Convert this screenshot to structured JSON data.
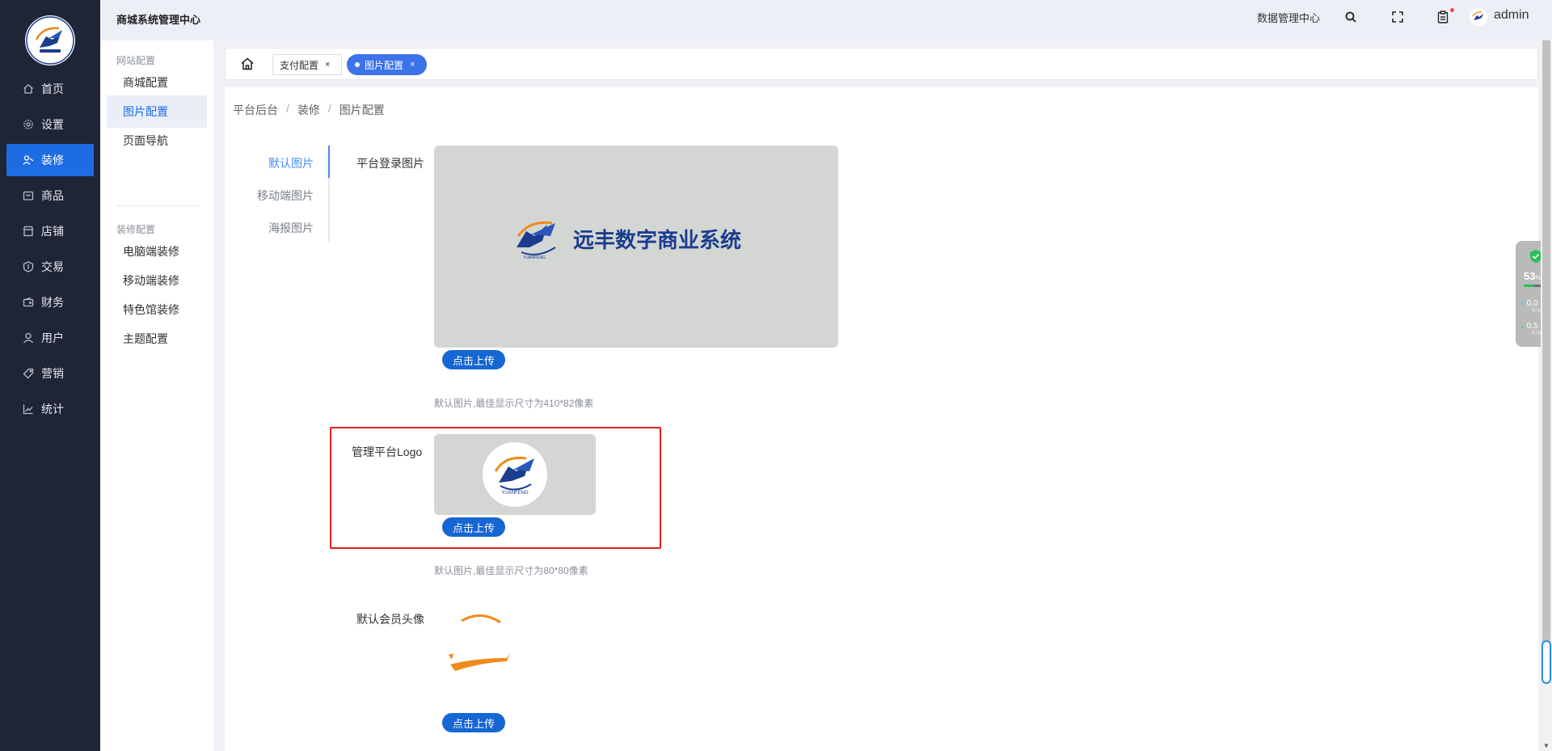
{
  "header": {
    "app_title": "商城系统管理中心",
    "data_center_link": "数据管理中心",
    "user_name": "admin",
    "icons": [
      "search-icon",
      "fullscreen-icon",
      "clipboard-icon"
    ]
  },
  "sidebar": {
    "items": [
      {
        "label": "首页",
        "icon": "home-icon"
      },
      {
        "label": "设置",
        "icon": "gear-icon"
      },
      {
        "label": "装修",
        "icon": "decorate-icon",
        "active": true
      },
      {
        "label": "商品",
        "icon": "goods-icon"
      },
      {
        "label": "店铺",
        "icon": "shop-icon"
      },
      {
        "label": "交易",
        "icon": "trade-icon"
      },
      {
        "label": "财务",
        "icon": "wallet-icon"
      },
      {
        "label": "用户",
        "icon": "user-icon"
      },
      {
        "label": "营销",
        "icon": "tag-icon"
      },
      {
        "label": "统计",
        "icon": "chart-icon"
      }
    ]
  },
  "submenu": {
    "groups": [
      {
        "title": "网站配置",
        "items": [
          "商城配置",
          "图片配置",
          "页面导航"
        ]
      },
      {
        "title": "装修配置",
        "items": [
          "电脑端装修",
          "移动端装修",
          "特色馆装修",
          "主题配置"
        ]
      }
    ],
    "active_item": "图片配置"
  },
  "tabs": {
    "items": [
      {
        "label": "支付配置",
        "close": "×"
      },
      {
        "label": "图片配置",
        "close": "×",
        "active": true
      }
    ]
  },
  "breadcrumb": [
    "平台后台",
    "装修",
    "图片配置"
  ],
  "breadcrumb_sep": "/",
  "vertical_tabs": {
    "items": [
      "默认图片",
      "移动端图片",
      "海报图片"
    ],
    "active": "默认图片"
  },
  "fields": {
    "login_image": {
      "label": "平台登录图片",
      "brand_text": "远丰数字商业系统",
      "button": "点击上传",
      "hint": "默认图片,最佳显示尺寸为410*82像素"
    },
    "logo": {
      "label": "管理平台Logo",
      "button": "点击上传",
      "hint": "默认图片,最佳显示尺寸为80*80像素"
    },
    "avatar": {
      "label": "默认会员头像",
      "button": "点击上传"
    }
  },
  "widget": {
    "percent": "53",
    "percent_unit": "%",
    "up_speed": "0.0",
    "down_speed": "0.5",
    "speed_unit": "K/s"
  },
  "colors": {
    "sidebar_bg": "#1f2537",
    "accent": "#1d6ce4",
    "highlight_border": "#e02020"
  }
}
